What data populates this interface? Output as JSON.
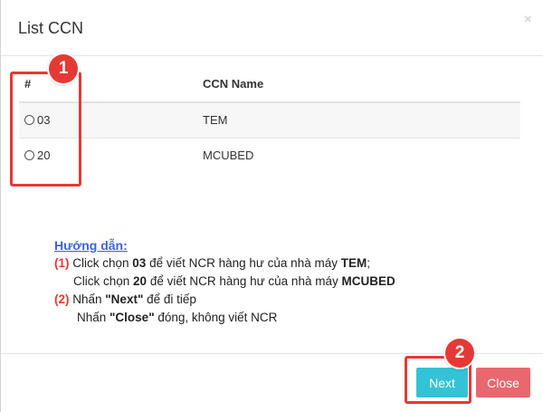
{
  "modal": {
    "title": "List CCN",
    "close_glyph": "×"
  },
  "table": {
    "headers": [
      "#",
      "CCN Name"
    ],
    "rows": [
      {
        "code": "03",
        "name": "TEM"
      },
      {
        "code": "20",
        "name": "MCUBED"
      }
    ]
  },
  "annotations": {
    "badge1": "1",
    "badge2": "2",
    "highlight_color": "#e53935"
  },
  "guide": {
    "title": "Hướng dẫn:",
    "line1_num": "(1)",
    "line1_a": " Click chọn ",
    "line1_code": "03",
    "line1_b": " để viết NCR hàng hư của nhà máy ",
    "line1_plant": "TEM",
    "line1_end": ";",
    "line2_a": "Click chọn ",
    "line2_code": "20",
    "line2_b": " để viết NCR hàng hư của nhà máy ",
    "line2_plant": "MCUBED",
    "line3_num": "(2)",
    "line3_a": " Nhấn ",
    "line3_btn": "\"Next\"",
    "line3_b": " để đi tiếp",
    "line4_a": "Nhấn ",
    "line4_btn": "\"Close\"",
    "line4_b": " đóng, không viết NCR"
  },
  "footer": {
    "next_label": "Next",
    "close_label": "Close"
  },
  "colors": {
    "next_button": "#33c3d6",
    "close_button": "#e9676f",
    "guide_title": "#3b62e0"
  }
}
